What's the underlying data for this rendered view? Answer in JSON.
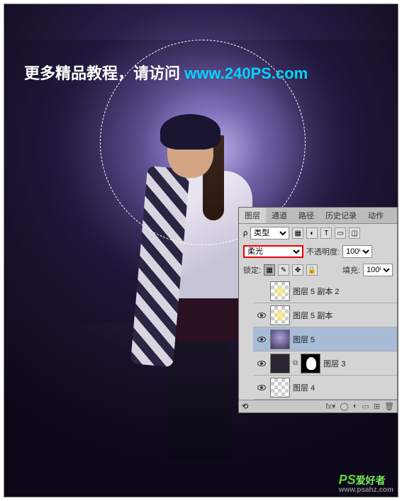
{
  "banner": {
    "text": "更多精品教程，请访问 ",
    "url": "www.240PS.com"
  },
  "watermark": {
    "brand": "PS",
    "suffix": "爱好者",
    "site": "www.psahz.com"
  },
  "panel": {
    "tabs": [
      "图层",
      "通道",
      "路径",
      "历史记录",
      "动作"
    ],
    "filter_label": "类型",
    "blend_mode": "柔光",
    "opacity_label": "不透明度:",
    "opacity_value": "100%",
    "lock_label": "锁定:",
    "fill_label": "填充:",
    "fill_value": "100%",
    "layers": [
      {
        "name": "图层 5 副本 2",
        "visible": false,
        "selected": false,
        "thumb": "checker-glow"
      },
      {
        "name": "图层 5 副本",
        "visible": true,
        "selected": false,
        "thumb": "checker-glow"
      },
      {
        "name": "图层 5",
        "visible": true,
        "selected": true,
        "thumb": "purple"
      },
      {
        "name": "图层 3",
        "visible": true,
        "selected": false,
        "thumb": "dark-mask"
      },
      {
        "name": "图层 4",
        "visible": true,
        "selected": false,
        "thumb": "checker-dark"
      }
    ]
  }
}
